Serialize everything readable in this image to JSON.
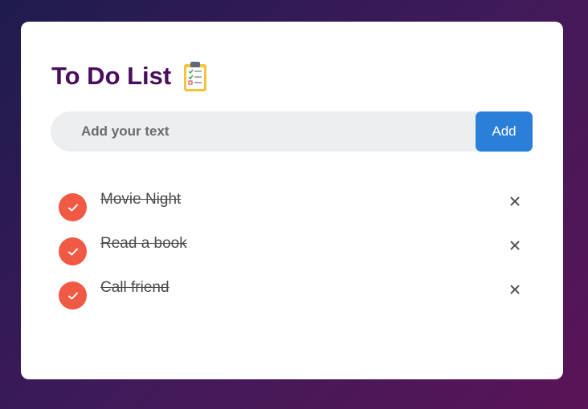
{
  "header": {
    "title": "To Do List",
    "icon": "clipboard-checklist-icon"
  },
  "input": {
    "placeholder": "Add your text",
    "value": "",
    "add_label": "Add"
  },
  "tasks": [
    {
      "label": "Movie Night",
      "completed": true
    },
    {
      "label": "Read a book",
      "completed": true
    },
    {
      "label": "Call friend",
      "completed": true
    }
  ],
  "colors": {
    "title": "#4a0c5c",
    "accent": "#2a7fd9",
    "check": "#f05a44",
    "input_bg": "#edeef0"
  }
}
